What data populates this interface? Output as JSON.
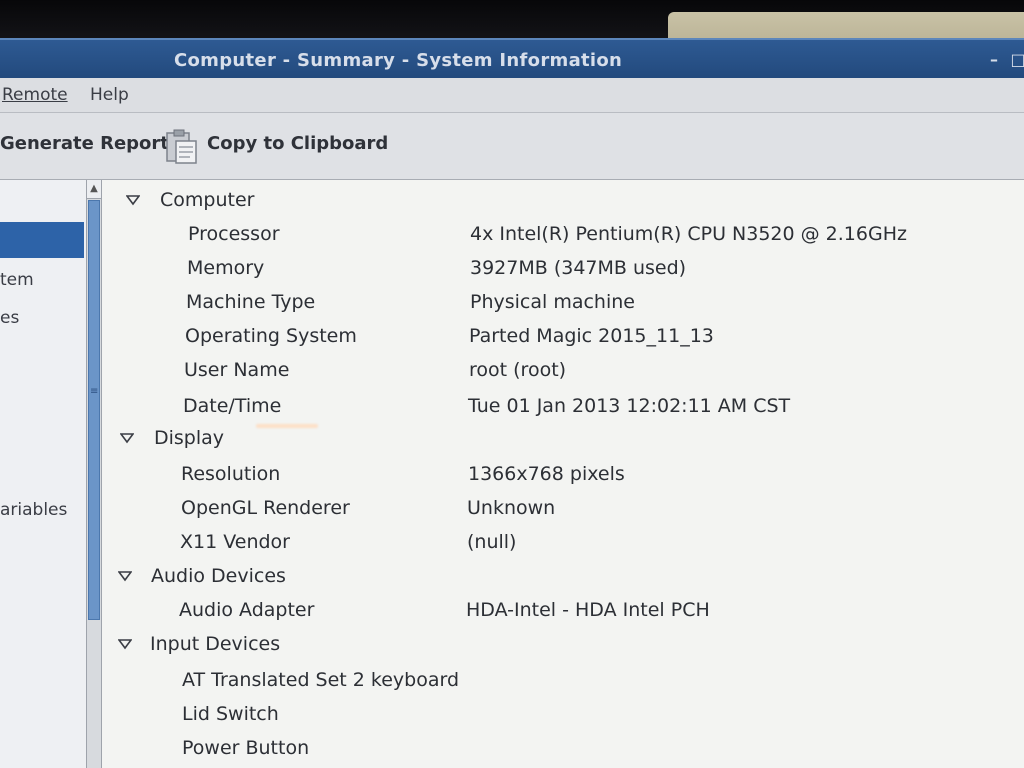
{
  "window": {
    "title": "Computer - Summary - System Information",
    "minimize_glyph": "–",
    "close_glyph": "□"
  },
  "menubar": {
    "items": [
      {
        "label": "Remote"
      },
      {
        "label": "Help"
      }
    ]
  },
  "toolbar": {
    "generate_report_label": "Generate Report",
    "copy_clipboard_label": "Copy to Clipboard",
    "copy_icon": "clipboard-icon"
  },
  "sidebar": {
    "items": [
      {
        "label": "tem"
      },
      {
        "label": "es"
      },
      {
        "label": "ariables"
      }
    ],
    "selected_color": "#2d63a8"
  },
  "sections": [
    {
      "label": "Computer",
      "rows": [
        {
          "key": "Processor",
          "value": "4x Intel(R) Pentium(R) CPU  N3520  @ 2.16GHz"
        },
        {
          "key": "Memory",
          "value": "3927MB (347MB used)"
        },
        {
          "key": "Machine Type",
          "value": "Physical machine"
        },
        {
          "key": "Operating System",
          "value": "Parted Magic 2015_11_13"
        },
        {
          "key": "User Name",
          "value": "root (root)"
        },
        {
          "key": "Date/Time",
          "value": "Tue 01 Jan 2013 12:02:11 AM CST"
        }
      ]
    },
    {
      "label": "Display",
      "rows": [
        {
          "key": "Resolution",
          "value": "1366x768 pixels"
        },
        {
          "key": "OpenGL Renderer",
          "value": "Unknown"
        },
        {
          "key": "X11 Vendor",
          "value": "(null)"
        }
      ]
    },
    {
      "label": "Audio Devices",
      "rows": [
        {
          "key": "Audio Adapter",
          "value": "HDA-Intel - HDA Intel PCH"
        }
      ]
    },
    {
      "label": "Input Devices",
      "rows": [
        {
          "key": "AT Translated Set 2 keyboard",
          "value": ""
        },
        {
          "key": "Lid Switch",
          "value": ""
        },
        {
          "key": "Power Button",
          "value": ""
        }
      ]
    }
  ],
  "colors": {
    "titlebar": "#2e5a93",
    "selection": "#2d63a8",
    "scrollbar_thumb": "#6b95c8"
  }
}
